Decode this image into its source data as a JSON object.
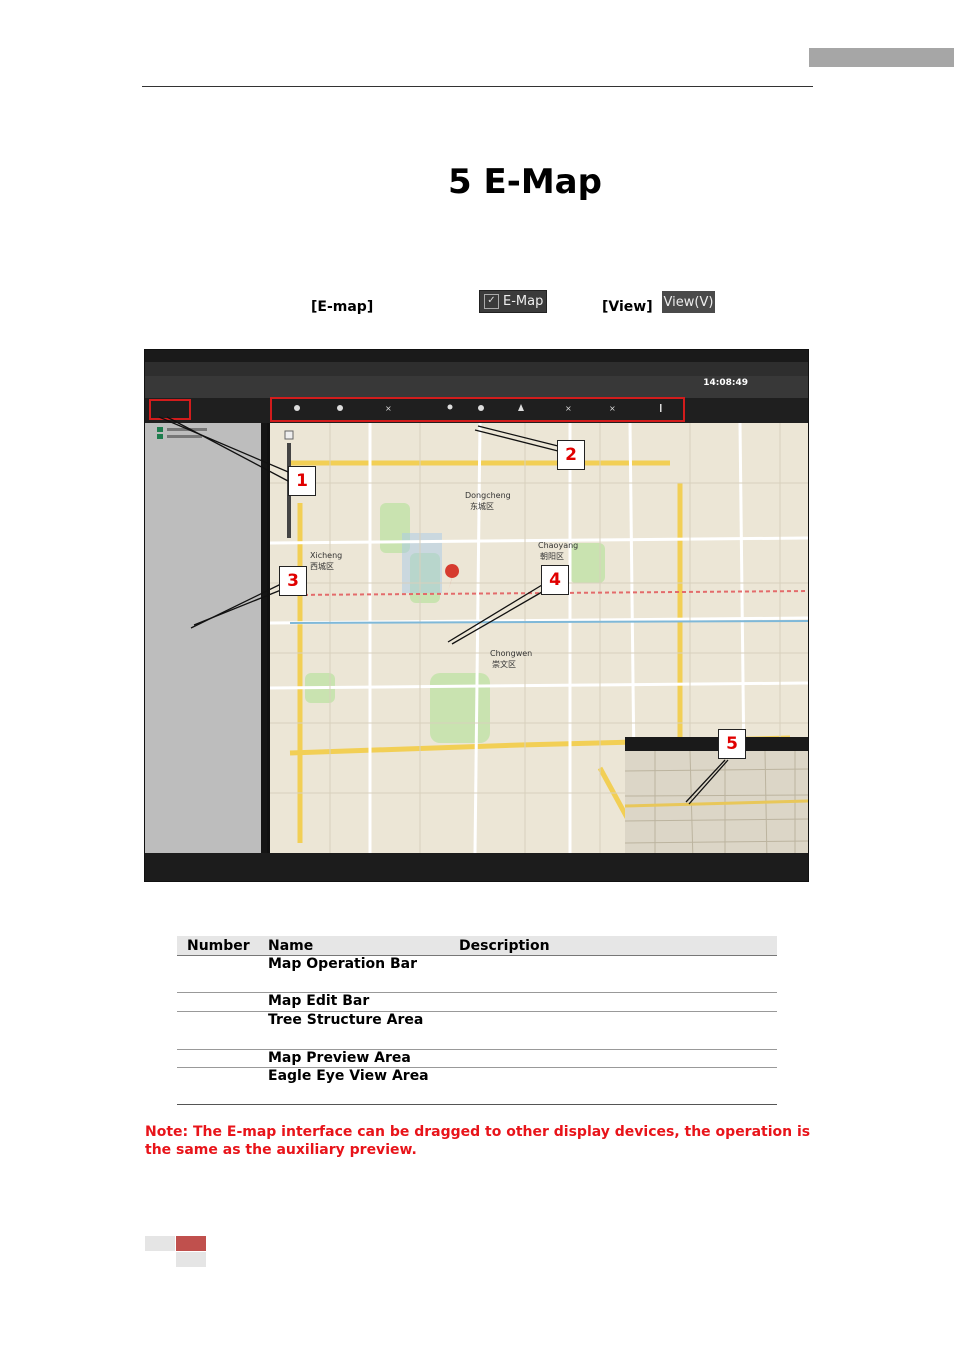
{
  "chapter_title": "5 E-Map",
  "intro": {
    "emap_label": "[E-map]",
    "emap_button_text": "E-Map",
    "view_label": "[View]",
    "view_button_text": "View(V)"
  },
  "screenshot": {
    "clock": "14:08:49",
    "callouts": [
      "1",
      "2",
      "3",
      "4",
      "5"
    ],
    "map_labels": [
      "Dongcheng",
      "东城区",
      "Chaoyang",
      "朝阳区",
      "Xicheng",
      "西城区",
      "Chongwen",
      "崇文区"
    ]
  },
  "table": {
    "headers": [
      "Number",
      "Name",
      "Description"
    ],
    "rows": [
      {
        "number": "",
        "name": "Map Operation Bar",
        "description": ""
      },
      {
        "number": "",
        "name": "Map Edit Bar",
        "description": ""
      },
      {
        "number": "",
        "name": "Tree Structure Area",
        "description": ""
      },
      {
        "number": "",
        "name": "Map Preview Area",
        "description": ""
      },
      {
        "number": "",
        "name": "Eagle Eye View Area",
        "description": ""
      }
    ]
  },
  "note_lines": [
    "Note: The E-map interface can be dragged to other display devices, the operation is",
    "the same as the auxiliary preview."
  ]
}
